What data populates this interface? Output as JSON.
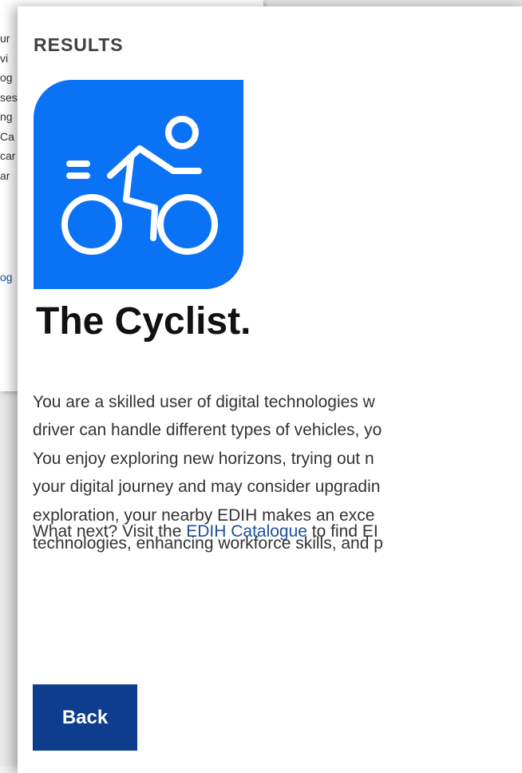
{
  "background": {
    "text_fragments": [
      "ur",
      "vi",
      "og",
      "ses",
      "ng",
      "Ca",
      "car",
      "ar"
    ],
    "link_fragment": "og"
  },
  "results": {
    "label": "RESULTS",
    "icon": "cyclist-icon",
    "accent_color": "#0a72f5",
    "title": "The Cyclist.",
    "description_lines": [
      "You are a skilled user of digital technologies w",
      "driver can handle different types of vehicles, yo",
      "You enjoy exploring new horizons, trying out n",
      "your digital journey and may consider upgradin",
      "exploration, your nearby EDIH makes an exce",
      "technologies, enhancing workforce skills, and p"
    ],
    "next": {
      "prefix": "What next? Visit the ",
      "link_label": "EDIH Catalogue",
      "suffix": " to find EI"
    },
    "back_label": "Back",
    "button_color": "#0d3d8c",
    "link_color": "#1b4f9c"
  }
}
